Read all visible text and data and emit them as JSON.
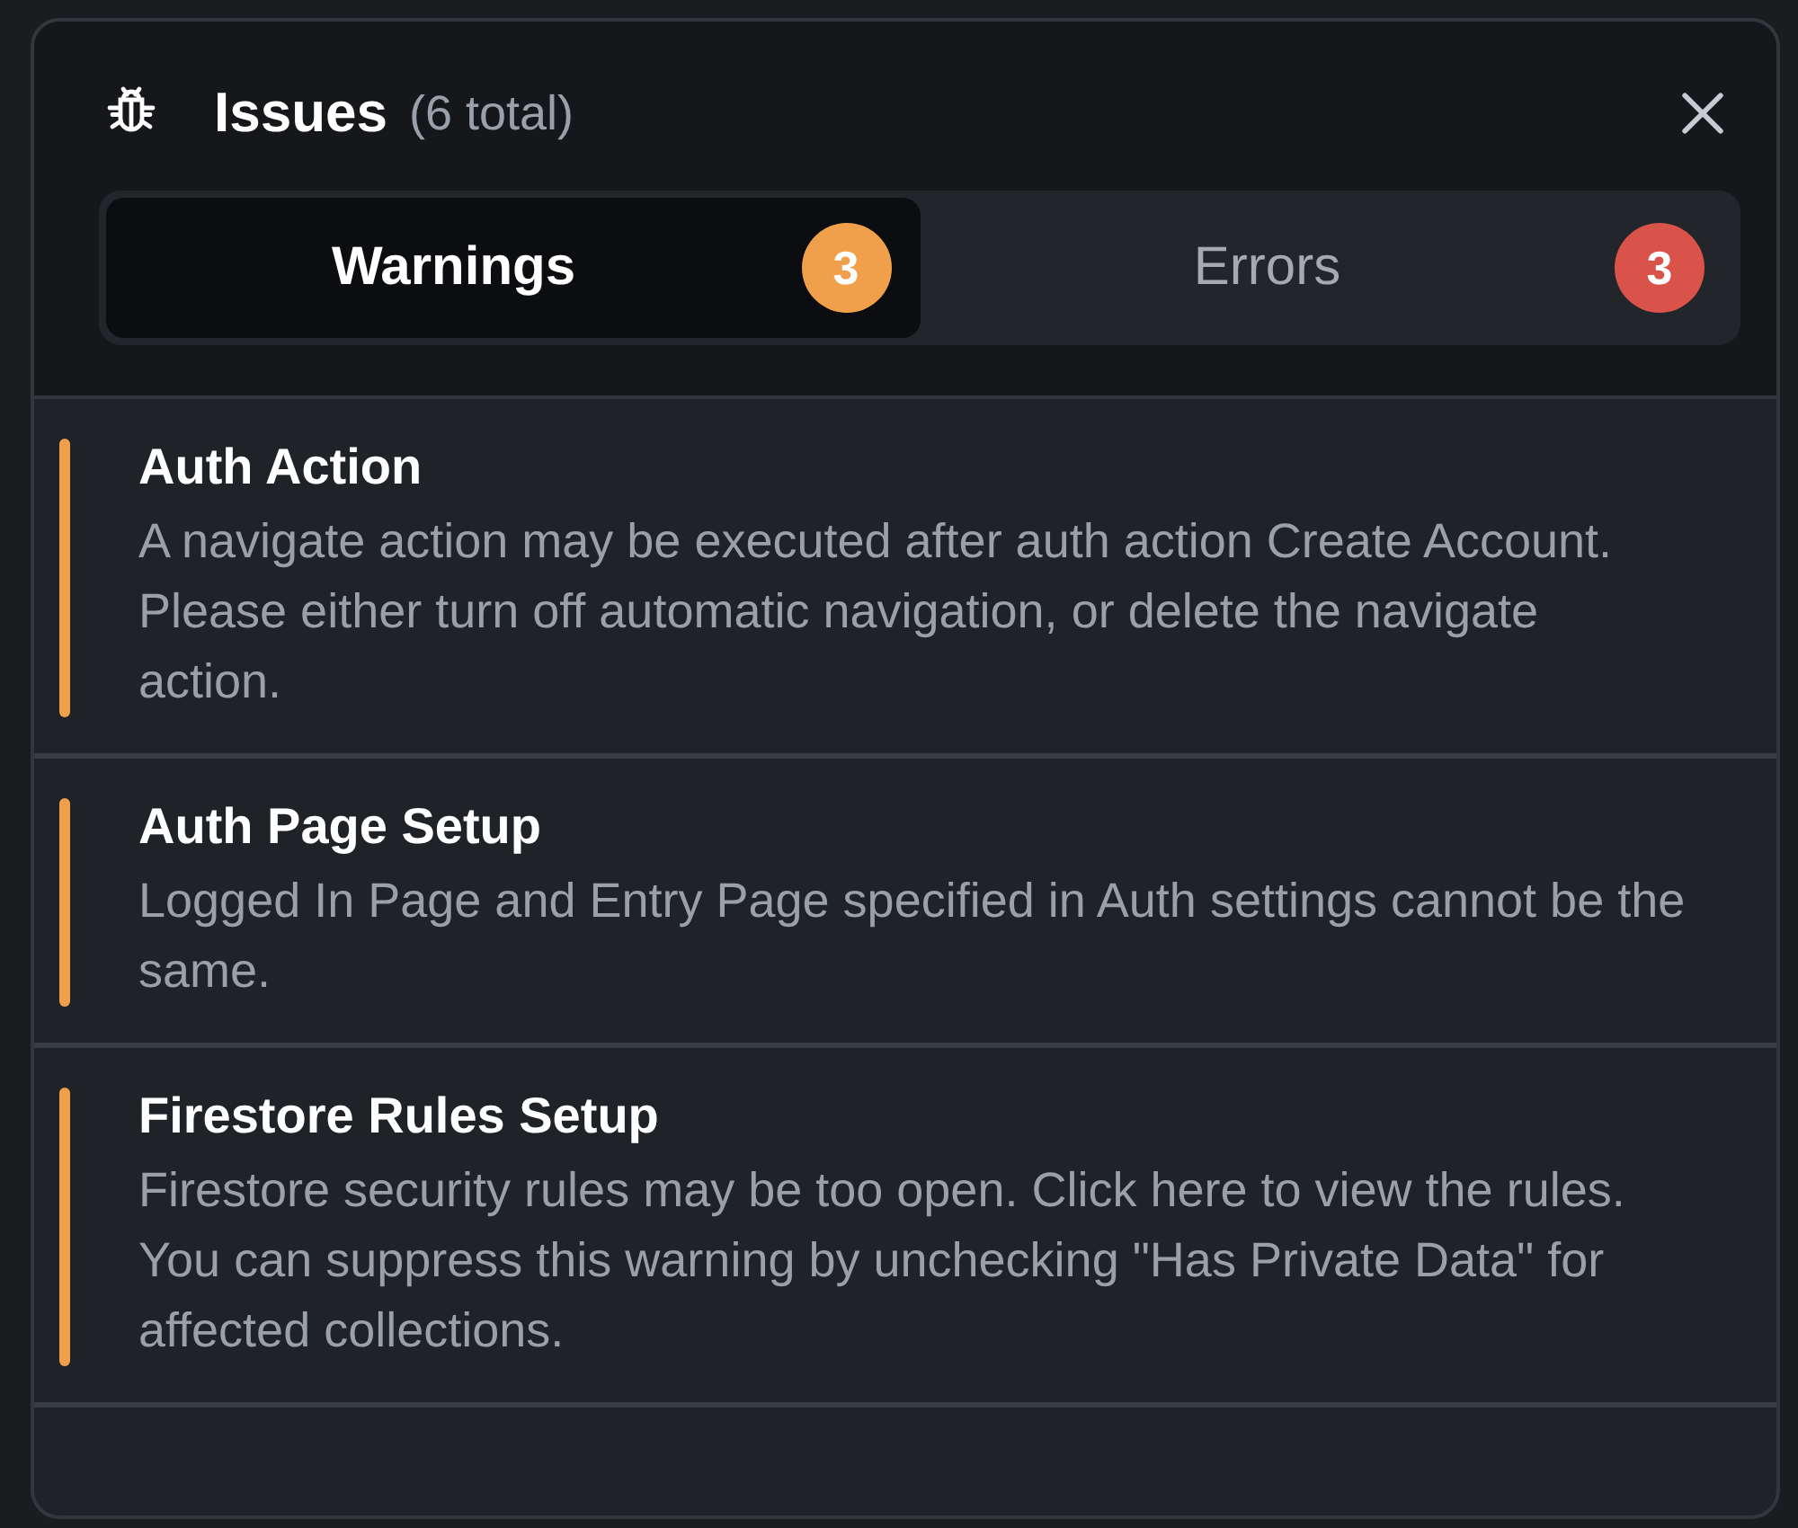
{
  "panel": {
    "title": "Issues",
    "total": "(6 total)"
  },
  "tabs": [
    {
      "label": "Warnings",
      "count": "3",
      "kind": "warning",
      "selected": true
    },
    {
      "label": "Errors",
      "count": "3",
      "kind": "error",
      "selected": false
    }
  ],
  "issues": [
    {
      "kind": "warning",
      "title": "Auth Action",
      "description": "A navigate action may be executed after auth action Create Account. Please either turn off automatic navigation, or delete the navigate action."
    },
    {
      "kind": "warning",
      "title": "Auth Page Setup",
      "description": "Logged In Page and Entry Page specified in Auth settings cannot be the same."
    },
    {
      "kind": "warning",
      "title": "Firestore Rules Setup",
      "description": "Firestore security rules may be too open. Click here to view the rules. You can suppress this warning by unchecking \"Has Private Data\" for affected collections."
    }
  ]
}
